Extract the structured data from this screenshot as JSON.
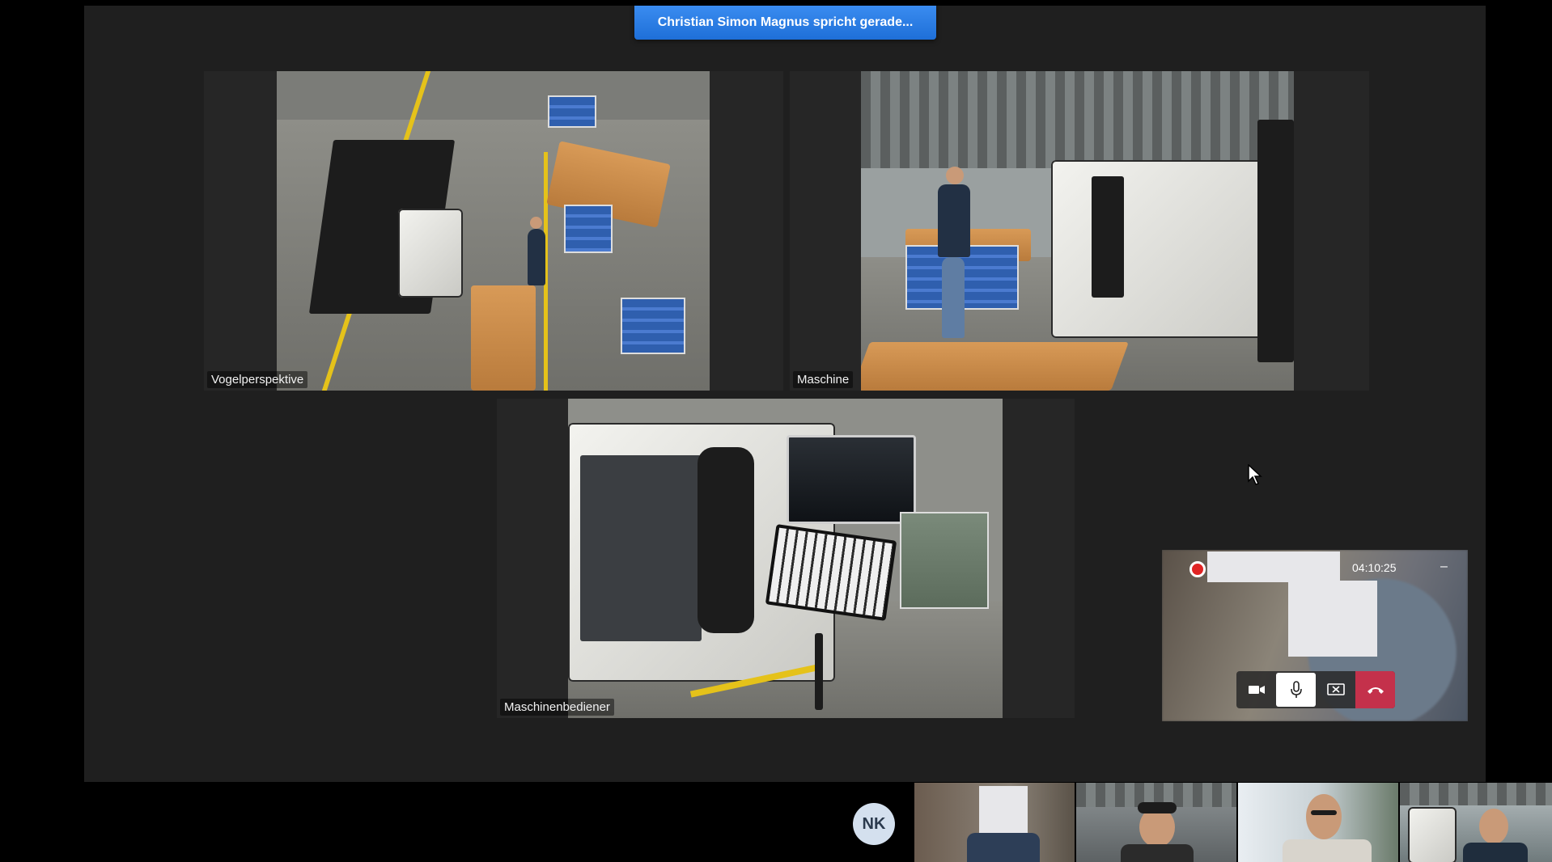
{
  "banner": {
    "text": "Christian Simon Magnus spricht gerade..."
  },
  "tiles": [
    {
      "label": "Vogelperspektive"
    },
    {
      "label": "Maschine"
    },
    {
      "label": "Maschinenbediener"
    }
  ],
  "self_view": {
    "recording": true,
    "timer": "04:10:25",
    "minimize_glyph": "–",
    "controls": [
      {
        "name": "camera-icon",
        "active": false
      },
      {
        "name": "microphone-icon",
        "active": true
      },
      {
        "name": "stop-share-icon",
        "active": false
      },
      {
        "name": "hang-up-icon",
        "active": false
      }
    ]
  },
  "filmstrip": {
    "avatar_initials": "NK",
    "thumbnails": 4
  },
  "colors": {
    "banner": "#1e6fd8",
    "hangup": "#c4314b",
    "recording": "#e02424",
    "stage_bg": "#1f1f1f"
  }
}
